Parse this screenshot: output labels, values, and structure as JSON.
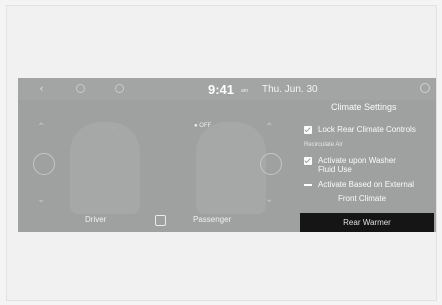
{
  "status_bar": {
    "time": "9:41",
    "time_suffix": "am",
    "date": "Thu. Jun. 30"
  },
  "left_area": {
    "airflow_icon": "airflow-icon",
    "off_text": "OFF",
    "driver_label": "Driver",
    "passenger_label": "Passenger",
    "seat_icon": "seat-icon"
  },
  "settings": {
    "title": "Climate Settings",
    "lock_label": "Lock Rear Climate Controls",
    "recirculate_heading": "Recirculate Air",
    "washer_label": "Activate upon Washer Fluid Use",
    "external_label": "Activate Based on External",
    "front_label": "Front Climate",
    "rear_label": "Rear Warmer"
  }
}
